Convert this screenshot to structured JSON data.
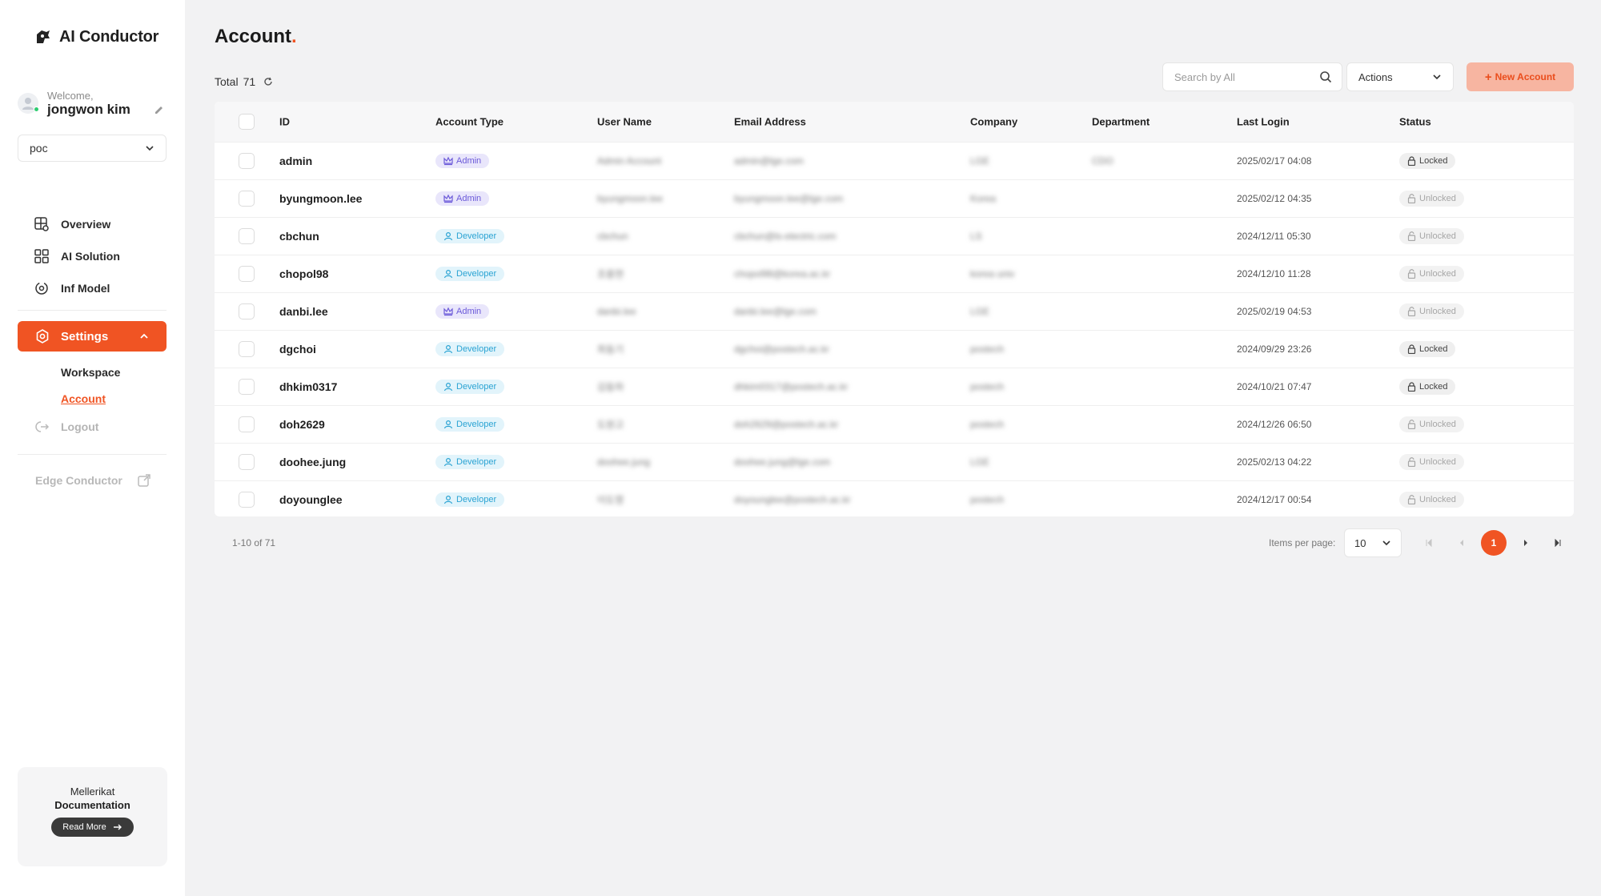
{
  "app": {
    "name": "AI Conductor"
  },
  "user": {
    "welcome": "Welcome,",
    "name": "jongwon kim"
  },
  "workspace_select": {
    "value": "poc"
  },
  "nav": {
    "items": [
      {
        "label": "Overview",
        "icon": "globe-search-icon"
      },
      {
        "label": "AI Solution",
        "icon": "grid-icon"
      },
      {
        "label": "Inf Model",
        "icon": "refresh-gear-icon"
      }
    ],
    "settings": "Settings",
    "sub": {
      "workspace": "Workspace",
      "account": "Account"
    },
    "logout": "Logout",
    "edge": "Edge Conductor"
  },
  "doc_card": {
    "line1": "Mellerikat",
    "line2": "Documentation",
    "button": "Read More"
  },
  "page": {
    "title": "Account",
    "total_label": "Total",
    "total_value": "71"
  },
  "search": {
    "placeholder": "Search by All"
  },
  "actions": {
    "label": "Actions"
  },
  "new_account": {
    "label": "New Account"
  },
  "table": {
    "headers": [
      "ID",
      "Account Type",
      "User Name",
      "Email Address",
      "Company",
      "Department",
      "Last Login",
      "Status"
    ],
    "rows": [
      {
        "id": "admin",
        "type": "Admin",
        "user": "Admin Account",
        "email": "admin@lge.com",
        "company": "LGE",
        "dept": "CDO",
        "last": "2025/02/17 04:08",
        "status": "Locked"
      },
      {
        "id": "byungmoon.lee",
        "type": "Admin",
        "user": "byungmoon.lee",
        "email": "byungmoon.lee@lge.com",
        "company": "Korea",
        "dept": "",
        "last": "2025/02/12 04:35",
        "status": "Unlocked"
      },
      {
        "id": "cbchun",
        "type": "Developer",
        "user": "cbchun",
        "email": "cbchun@ls-electric.com",
        "company": "LS",
        "dept": "",
        "last": "2024/12/11 05:30",
        "status": "Unlocked"
      },
      {
        "id": "chopol98",
        "type": "Developer",
        "user": "조용현",
        "email": "chopol98@korea.ac.kr",
        "company": "korea univ",
        "dept": "",
        "last": "2024/12/10 11:28",
        "status": "Unlocked"
      },
      {
        "id": "danbi.lee",
        "type": "Admin",
        "user": "danbi.lee",
        "email": "danbi.lee@lge.com",
        "company": "LGE",
        "dept": "",
        "last": "2025/02/19 04:53",
        "status": "Unlocked"
      },
      {
        "id": "dgchoi",
        "type": "Developer",
        "user": "최동기",
        "email": "dgchoi@postech.ac.kr",
        "company": "postech",
        "dept": "",
        "last": "2024/09/29 23:26",
        "status": "Locked"
      },
      {
        "id": "dhkim0317",
        "type": "Developer",
        "user": "김동하",
        "email": "dhkim0317@postech.ac.kr",
        "company": "postech",
        "dept": "",
        "last": "2024/10/21 07:47",
        "status": "Locked"
      },
      {
        "id": "doh2629",
        "type": "Developer",
        "user": "도원고",
        "email": "doh2629@postech.ac.kr",
        "company": "postech",
        "dept": "",
        "last": "2024/12/26 06:50",
        "status": "Unlocked"
      },
      {
        "id": "doohee.jung",
        "type": "Developer",
        "user": "doohee.jung",
        "email": "doohee.jung@lge.com",
        "company": "LGE",
        "dept": "",
        "last": "2025/02/13 04:22",
        "status": "Unlocked"
      },
      {
        "id": "doyounglee",
        "type": "Developer",
        "user": "이도영",
        "email": "doyounglee@postech.ac.kr",
        "company": "postech",
        "dept": "",
        "last": "2024/12/17 00:54",
        "status": "Unlocked"
      }
    ]
  },
  "pagination": {
    "range": "1-10 of 71",
    "items_per_page_label": "Items per page:",
    "items_per_page": "10",
    "current_page": "1"
  },
  "colors": {
    "accent": "#f05423",
    "admin_badge": "#6b59d9",
    "developer_badge": "#2aa3d3"
  }
}
